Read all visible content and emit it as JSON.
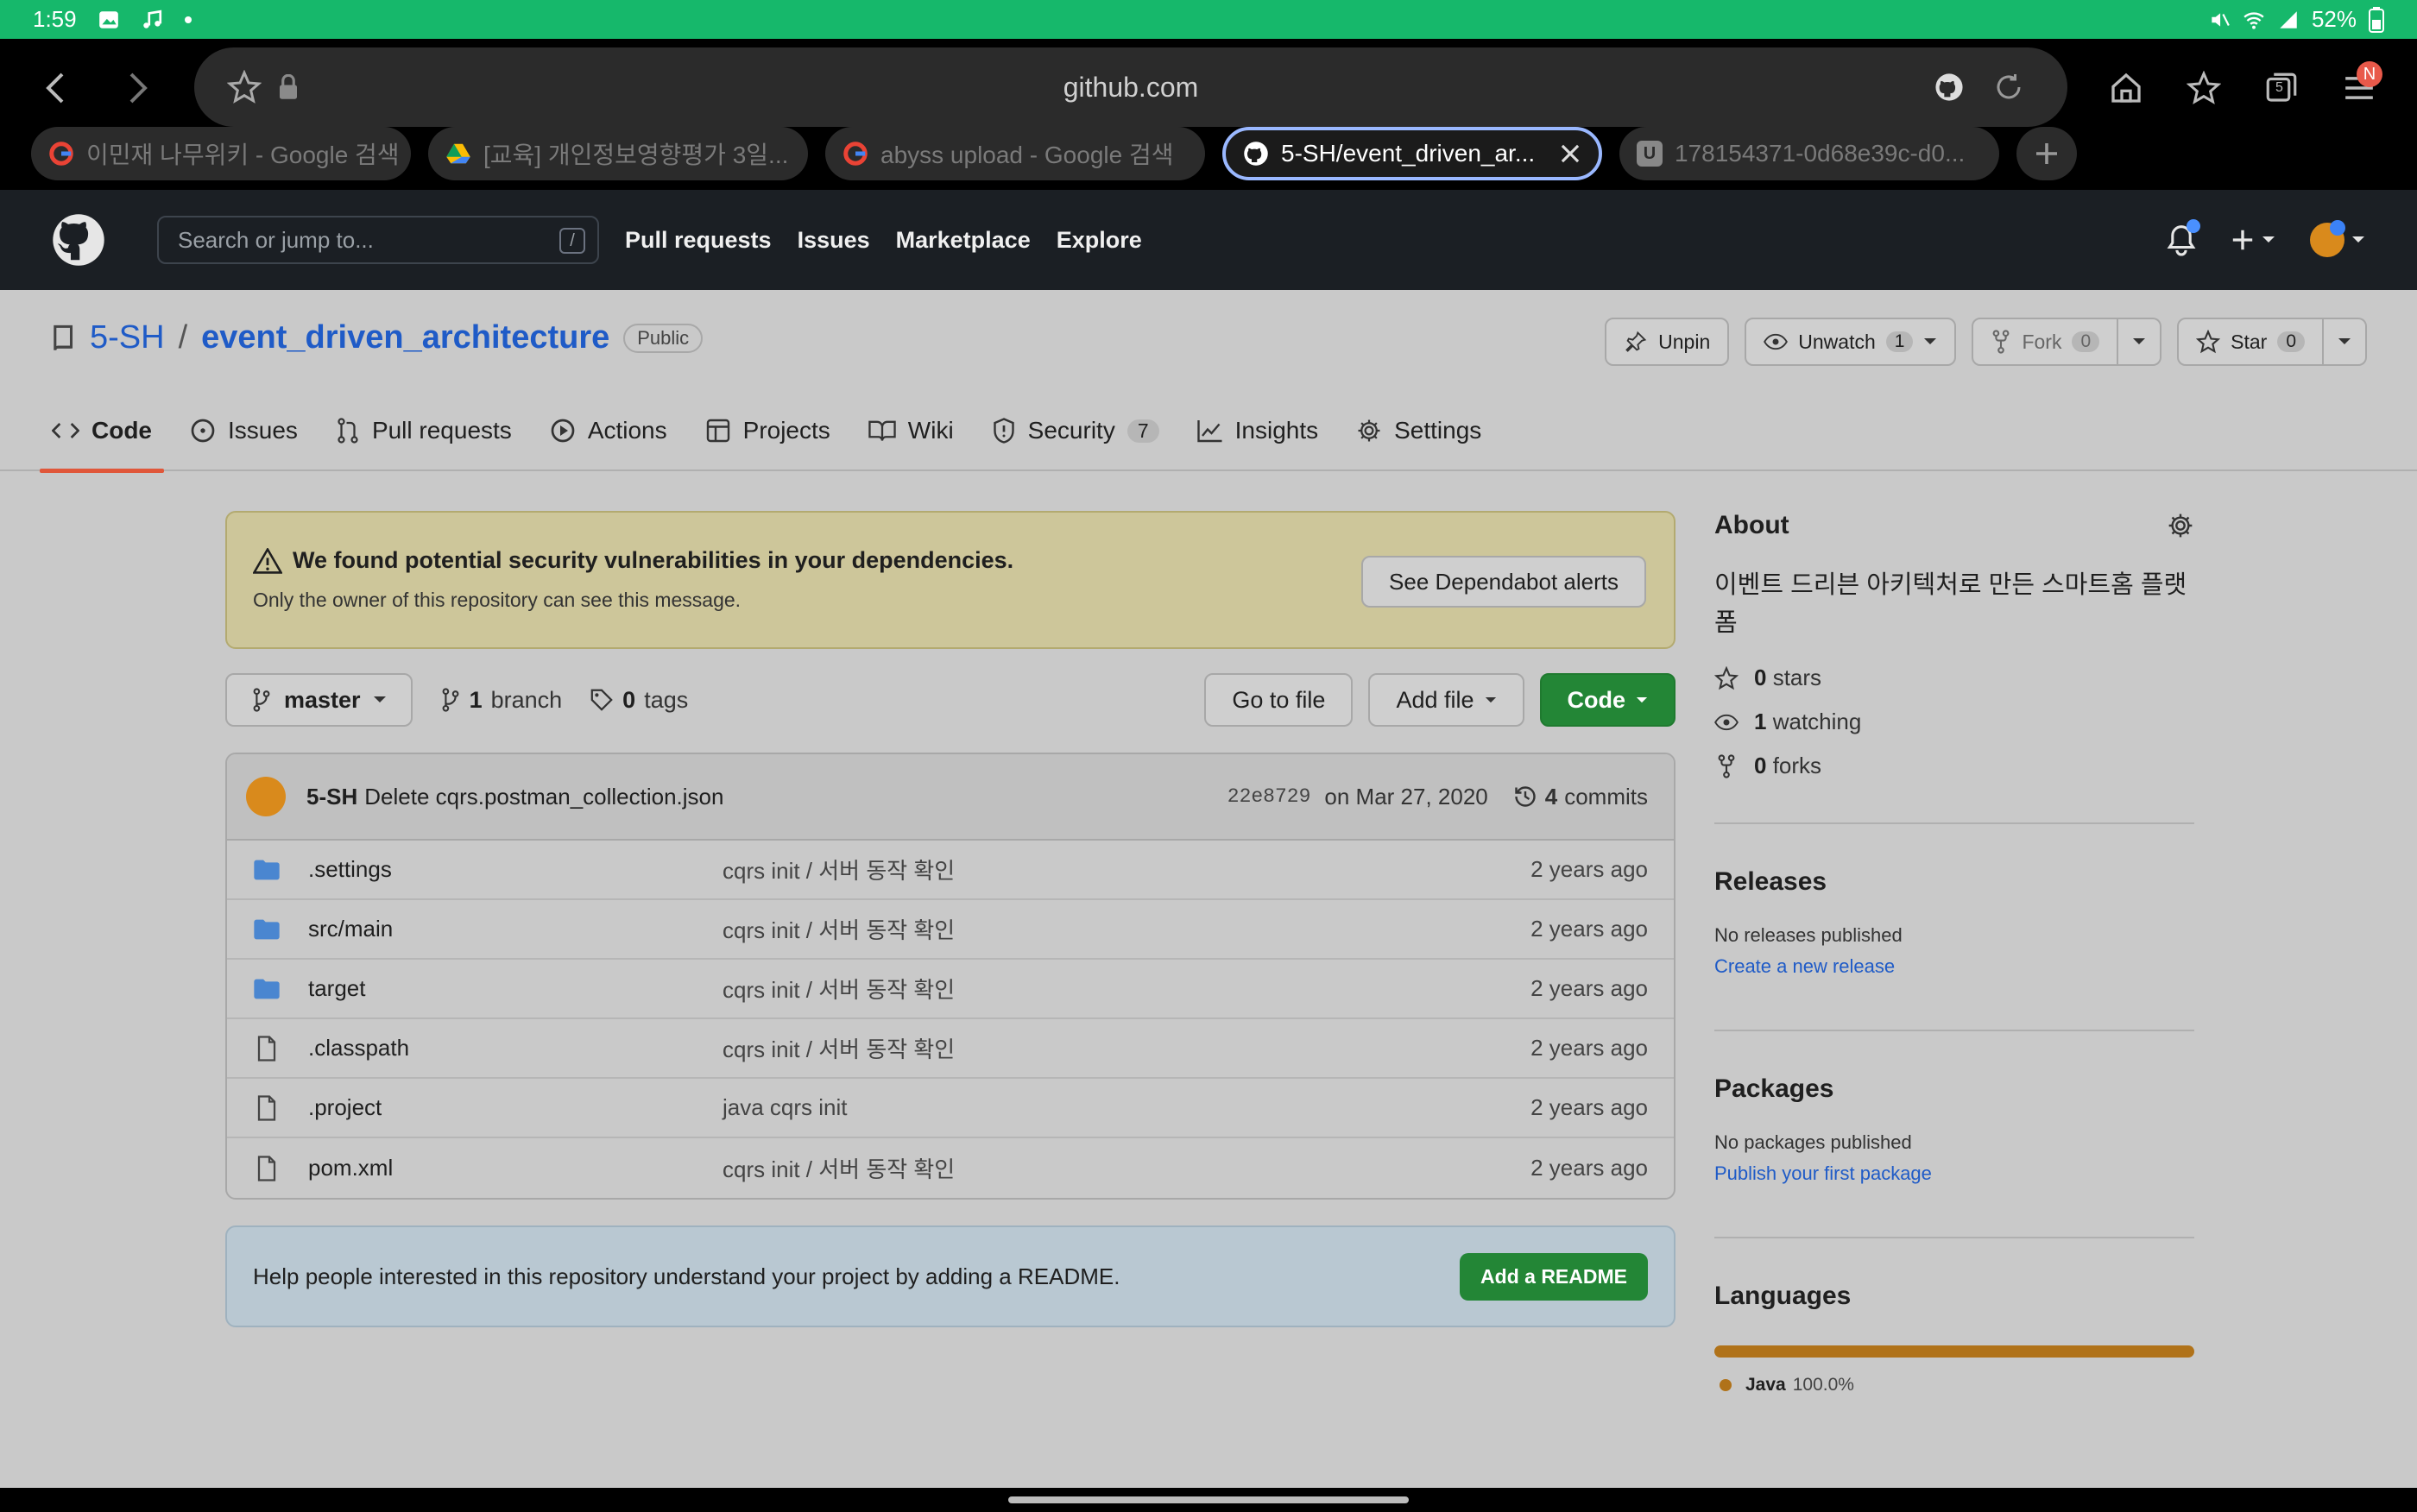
{
  "status_bar": {
    "time": "1:59",
    "battery": "52%"
  },
  "browser": {
    "url": "github.com",
    "tabs": [
      {
        "title": "이민재 나무위키 - Google 검색",
        "favicon": "google-icon"
      },
      {
        "title": "[교육] 개인정보영향평가 3일...",
        "favicon": "drive-icon"
      },
      {
        "title": "abyss upload - Google 검색",
        "favicon": "google-icon"
      },
      {
        "title": "5-SH/event_driven_ar...",
        "favicon": "github-icon",
        "active": true
      },
      {
        "title": "178154371-0d68e39c-d0...",
        "favicon": "u-icon"
      }
    ],
    "tab_count": "5",
    "profile_badge": "N",
    "favicon_u": "U"
  },
  "gh_header": {
    "search_placeholder": "Search or jump to...",
    "search_shortcut": "/",
    "nav": [
      "Pull requests",
      "Issues",
      "Marketplace",
      "Explore"
    ]
  },
  "repo": {
    "owner": "5-SH",
    "separator": "/",
    "name": "event_driven_architecture",
    "visibility": "Public",
    "unpin": "Unpin",
    "unwatch": "Unwatch",
    "watch_count": "1",
    "fork": "Fork",
    "fork_count": "0",
    "star": "Star",
    "star_count": "0",
    "tabs": [
      {
        "label": "Code",
        "icon": "code-icon"
      },
      {
        "label": "Issues",
        "icon": "issue-icon"
      },
      {
        "label": "Pull requests",
        "icon": "pr-icon"
      },
      {
        "label": "Actions",
        "icon": "play-icon"
      },
      {
        "label": "Projects",
        "icon": "table-icon"
      },
      {
        "label": "Wiki",
        "icon": "book-icon"
      },
      {
        "label": "Security",
        "icon": "shield-icon",
        "count": "7"
      },
      {
        "label": "Insights",
        "icon": "graph-icon"
      },
      {
        "label": "Settings",
        "icon": "gear-icon"
      }
    ]
  },
  "alert": {
    "title": "We found potential security vulnerabilities in your dependencies.",
    "subtitle": "Only the owner of this repository can see this message.",
    "button": "See Dependabot alerts"
  },
  "filebar": {
    "branch": "master",
    "branch_count": "1",
    "branch_label": "branch",
    "tag_count": "0",
    "tag_label": "tags",
    "go_to_file": "Go to file",
    "add_file": "Add file",
    "code": "Code"
  },
  "commit": {
    "author": "5-SH",
    "message": "Delete cqrs.postman_collection.json",
    "hash": "22e8729",
    "date": "on Mar 27, 2020",
    "count": "4",
    "count_label": "commits"
  },
  "files": [
    {
      "type": "folder",
      "name": ".settings",
      "message": "cqrs init / 서버 동작 확인",
      "age": "2 years ago"
    },
    {
      "type": "folder",
      "name": "src/main",
      "message": "cqrs init / 서버 동작 확인",
      "age": "2 years ago"
    },
    {
      "type": "folder",
      "name": "target",
      "message": "cqrs init / 서버 동작 확인",
      "age": "2 years ago"
    },
    {
      "type": "file",
      "name": ".classpath",
      "message": "cqrs init / 서버 동작 확인",
      "age": "2 years ago"
    },
    {
      "type": "file",
      "name": ".project",
      "message": "java cqrs init",
      "age": "2 years ago"
    },
    {
      "type": "file",
      "name": "pom.xml",
      "message": "cqrs init / 서버 동작 확인",
      "age": "2 years ago"
    }
  ],
  "readme": {
    "text": "Help people interested in this repository understand your project by adding a README.",
    "button": "Add a README"
  },
  "sidebar": {
    "about_title": "About",
    "description": "이벤트 드리븐 아키텍처로 만든 스마트홈 플랫폼",
    "stars_count": "0",
    "stars_label": "stars",
    "watching_count": "1",
    "watching_label": "watching",
    "forks_count": "0",
    "forks_label": "forks",
    "releases_title": "Releases",
    "releases_none": "No releases published",
    "releases_link": "Create a new release",
    "packages_title": "Packages",
    "packages_none": "No packages published",
    "packages_link": "Publish your first package",
    "languages_title": "Languages",
    "languages": [
      {
        "name": "Java",
        "percent": "100.0%",
        "color": "#b07219"
      }
    ]
  },
  "colors": {
    "accent_green": "#238636",
    "link": "#1f5bc7",
    "status_bar": "#16b86b"
  }
}
